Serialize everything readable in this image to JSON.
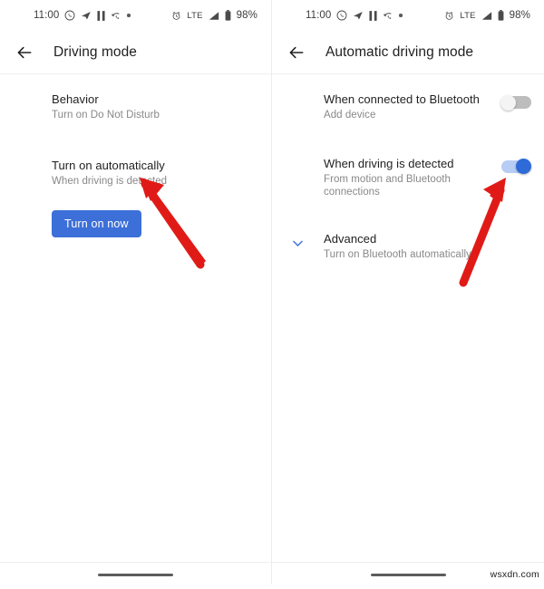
{
  "status_bar": {
    "time": "11:00",
    "left_icons": [
      "whatsapp-icon",
      "telegram-icon",
      "pause-icon",
      "missed-call-icon",
      "dot-icon"
    ],
    "alarm_icon": "alarm-icon",
    "network_label": "LTE",
    "signal_icon": "signal-bars-icon",
    "battery_icon": "battery-icon",
    "battery_percent": "98%"
  },
  "colors": {
    "accent_blue": "#3c6fd8",
    "toggle_on_track": "#b7cdf4",
    "toggle_on_knob": "#2f6ad9",
    "toggle_off_track": "#bdbdbd",
    "arrow_red": "#e01b17",
    "title_text": "#1f1f1f",
    "subtitle_text": "#888888"
  },
  "left_screen": {
    "back_icon": "back-arrow-icon",
    "title": "Driving mode",
    "rows": [
      {
        "title": "Behavior",
        "subtitle": "Turn on Do Not Disturb"
      },
      {
        "title": "Turn on automatically",
        "subtitle": "When driving is detected"
      }
    ],
    "button_label": "Turn on now"
  },
  "right_screen": {
    "back_icon": "back-arrow-icon",
    "title": "Automatic driving mode",
    "rows": [
      {
        "title": "When connected to Bluetooth",
        "subtitle": "Add device",
        "toggle": "off",
        "lead_icon": ""
      },
      {
        "title": "When driving is detected",
        "subtitle": "From motion and Bluetooth connections",
        "toggle": "on",
        "lead_icon": ""
      },
      {
        "title": "Advanced",
        "subtitle": "Turn on Bluetooth automatically",
        "toggle": "",
        "lead_icon": "chevron-down-icon"
      }
    ]
  },
  "annotations": {
    "left_arrow": "red-arrow-up-left",
    "right_arrow": "red-arrow-up-right"
  },
  "watermark": "wsxdn.com"
}
